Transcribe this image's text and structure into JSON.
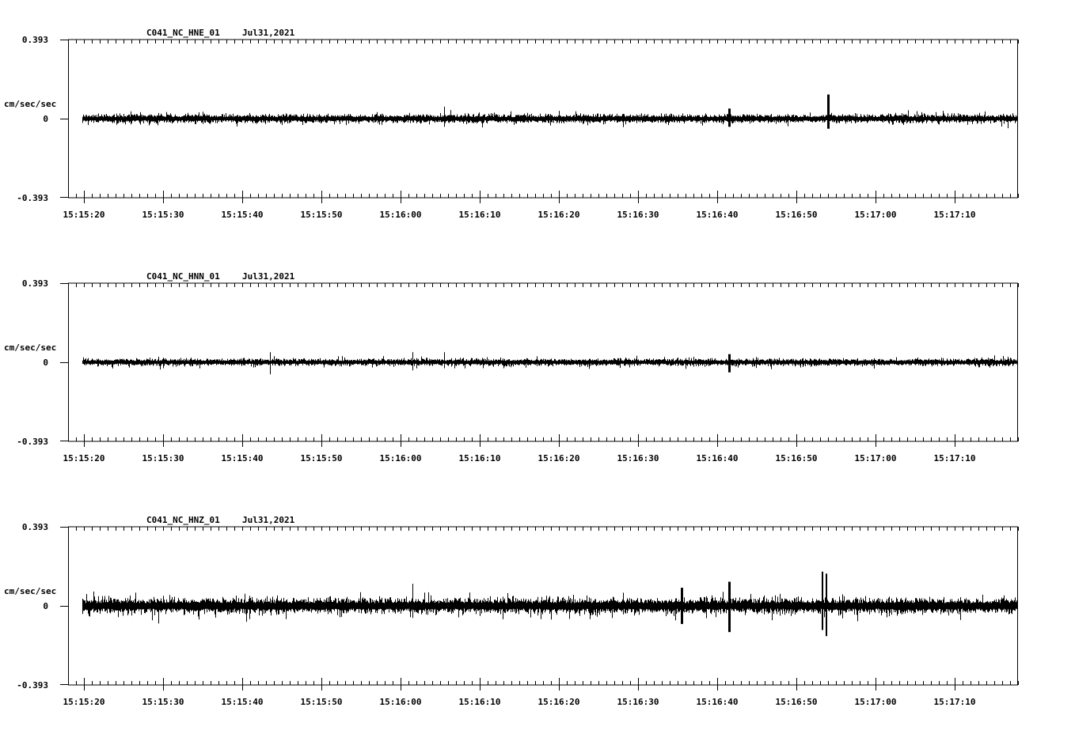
{
  "chart_data": [
    {
      "type": "line",
      "title": "C041_NC_HNE_01",
      "date": "Jul31,2021",
      "ylabel": "cm/sec/sec",
      "ylim": [
        -0.393,
        0.393
      ],
      "ytick_labels": [
        "0.393",
        "0",
        "-0.393"
      ],
      "xlim": [
        "15:15:18",
        "15:17:18"
      ],
      "xtick_labels": [
        "15:15:20",
        "15:15:30",
        "15:15:40",
        "15:15:50",
        "15:16:00",
        "15:16:10",
        "15:16:20",
        "15:16:30",
        "15:16:40",
        "15:16:50",
        "15:17:00",
        "15:17:10"
      ],
      "trace_start": "15:15:20",
      "noise_amplitude": 0.03,
      "spikes": [
        {
          "t": 45.5,
          "max": 0.06,
          "min": -0.04
        },
        {
          "t": 94,
          "max": 0.12,
          "min": -0.05
        },
        {
          "t": 81.5,
          "max": 0.05,
          "min": -0.04
        }
      ]
    },
    {
      "type": "line",
      "title": "C041_NC_HNN_01",
      "date": "Jul31,2021",
      "ylabel": "cm/sec/sec",
      "ylim": [
        -0.393,
        0.393
      ],
      "ytick_labels": [
        "0.393",
        "0",
        "-0.393"
      ],
      "xlim": [
        "15:15:18",
        "15:17:18"
      ],
      "xtick_labels": [
        "15:15:20",
        "15:15:30",
        "15:15:40",
        "15:15:50",
        "15:16:00",
        "15:16:10",
        "15:16:20",
        "15:16:30",
        "15:16:40",
        "15:16:50",
        "15:17:00",
        "15:17:10"
      ],
      "trace_start": "15:15:20",
      "noise_amplitude": 0.025,
      "spikes": [
        {
          "t": 23.5,
          "max": 0.05,
          "min": -0.06
        },
        {
          "t": 41.5,
          "max": 0.05,
          "min": -0.04
        },
        {
          "t": 45.5,
          "max": 0.05,
          "min": -0.03
        },
        {
          "t": 81.5,
          "max": 0.04,
          "min": -0.05
        }
      ]
    },
    {
      "type": "line",
      "title": "C041_NC_HNZ_01",
      "date": "Jul31,2021",
      "ylabel": "cm/sec/sec",
      "ylim": [
        -0.393,
        0.393
      ],
      "ytick_labels": [
        "0.393",
        "0",
        "-0.393"
      ],
      "xlim": [
        "15:15:18",
        "15:17:18"
      ],
      "xtick_labels": [
        "15:15:20",
        "15:15:30",
        "15:15:40",
        "15:15:50",
        "15:16:00",
        "15:16:10",
        "15:16:20",
        "15:16:30",
        "15:16:40",
        "15:16:50",
        "15:17:00",
        "15:17:10"
      ],
      "trace_start": "15:15:20",
      "noise_amplitude": 0.055,
      "spikes": [
        {
          "t": 41.5,
          "max": 0.11,
          "min": -0.06
        },
        {
          "t": 81.5,
          "max": 0.12,
          "min": -0.13
        },
        {
          "t": 93.2,
          "max": 0.17,
          "min": -0.12
        },
        {
          "t": 93.7,
          "max": 0.16,
          "min": -0.15
        },
        {
          "t": 75.5,
          "max": 0.09,
          "min": -0.09
        }
      ]
    }
  ]
}
